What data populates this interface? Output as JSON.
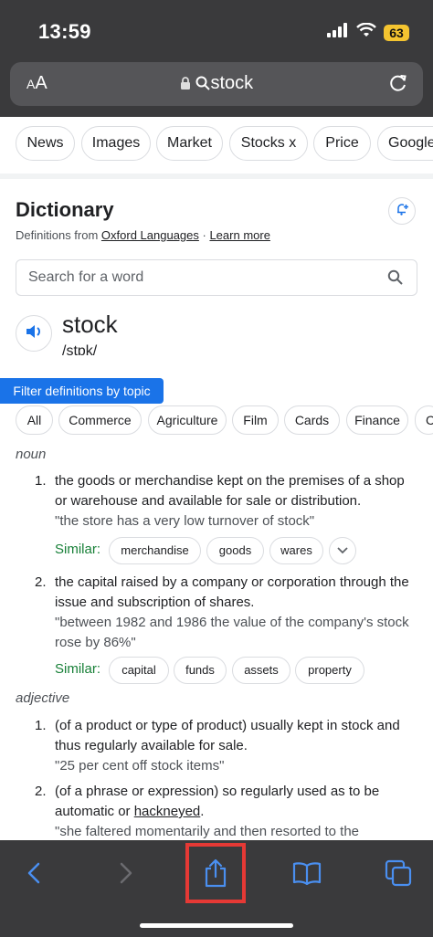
{
  "status": {
    "time": "13:59",
    "battery": "63"
  },
  "browser": {
    "aa_label_small": "A",
    "aa_label_large": "A",
    "url_text": "stock"
  },
  "chips": [
    "News",
    "Images",
    "Market",
    "Stocks x",
    "Price",
    "Google"
  ],
  "dictionary": {
    "title": "Dictionary",
    "source_prefix": "Definitions from ",
    "source_link": "Oxford Languages",
    "separator": " · ",
    "learn_more": "Learn more",
    "search_placeholder": "Search for a word",
    "word": "stock",
    "phonetic": "/stɒk/",
    "filter_tooltip": "Filter definitions by topic",
    "topics": [
      "All",
      "Commerce",
      "Agriculture",
      "Film",
      "Cards",
      "Finance",
      "C"
    ]
  },
  "entries": {
    "noun_label": "noun",
    "noun_1": {
      "num": "1.",
      "text": "the goods or merchandise kept on the premises of a shop or warehouse and available for sale or distribution.",
      "example": "\"the store has a very low turnover of stock\"",
      "similar_label": "Similar:",
      "similar": [
        "merchandise",
        "goods",
        "wares"
      ]
    },
    "noun_2": {
      "num": "2.",
      "text": "the capital raised by a company or corporation through the issue and subscription of shares.",
      "example": "\"between 1982 and 1986 the value of the company's stock rose by 86%\"",
      "similar_label": "Similar:",
      "similar": [
        "capital",
        "funds",
        "assets",
        "property"
      ]
    },
    "adjective_label": "adjective",
    "adj_1": {
      "num": "1.",
      "text": "(of a product or type of product) usually kept in stock and thus regularly available for sale.",
      "example": "\"25 per cent off stock items\""
    },
    "adj_2": {
      "num": "2.",
      "text_before": "(of a phrase or expression) so regularly used as to be automatic or ",
      "link": "hackneyed",
      "text_after": ".",
      "example": "\"she faltered momentarily and then resorted to the"
    }
  },
  "colors": {
    "bar": "#3a3a3c",
    "accent": "#1a73e8",
    "similar": "#188038",
    "highlight": "#e53935",
    "toolbar_icon": "#4a8ff0"
  }
}
